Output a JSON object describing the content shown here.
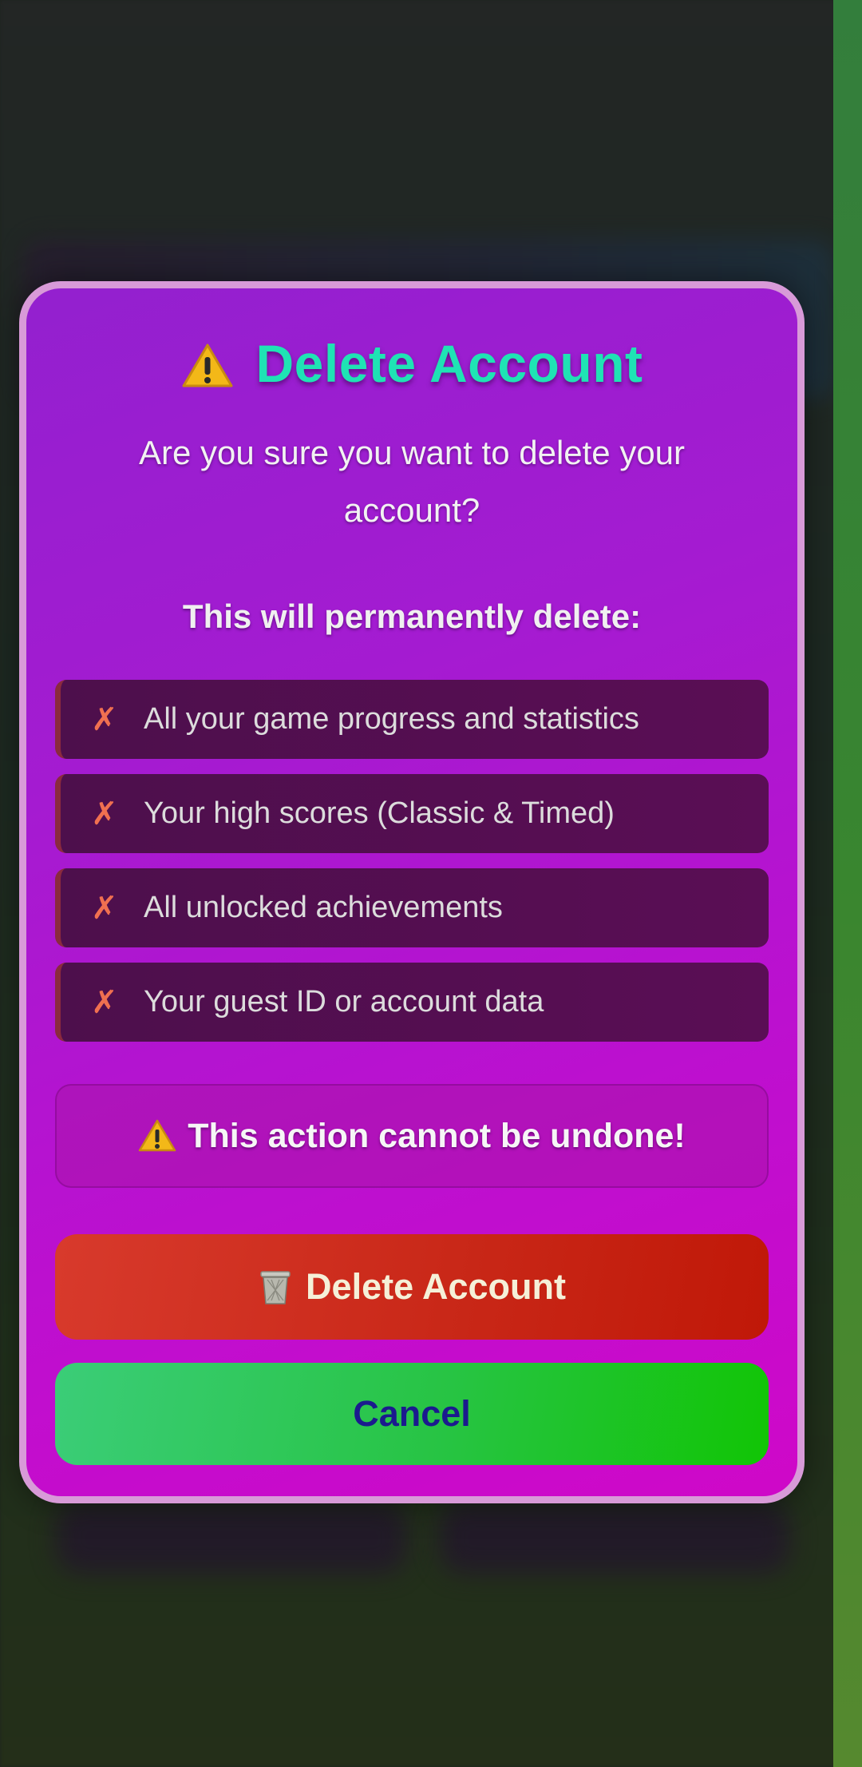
{
  "dialog": {
    "title": "Delete Account",
    "question": "Are you sure you want to delete your account?",
    "subheading": "This will permanently delete:",
    "items": [
      {
        "mark": "✗",
        "text": "All your game progress and statistics"
      },
      {
        "mark": "✗",
        "text": "Your high scores (Classic & Timed)"
      },
      {
        "mark": "✗",
        "text": "All unlocked achievements"
      },
      {
        "mark": "✗",
        "text": "Your guest ID or account data"
      }
    ],
    "warning": "This action cannot be undone!",
    "delete_label": "Delete Account",
    "cancel_label": "Cancel",
    "icons": {
      "title": "warning-icon",
      "warning": "warning-icon",
      "delete": "trash-icon"
    }
  },
  "colors": {
    "title": "#1fe3b4",
    "modal_border": "#d89ad8",
    "delete_button": "#c92818",
    "cancel_button": "#27c443",
    "cancel_text": "#1b1a8e"
  }
}
